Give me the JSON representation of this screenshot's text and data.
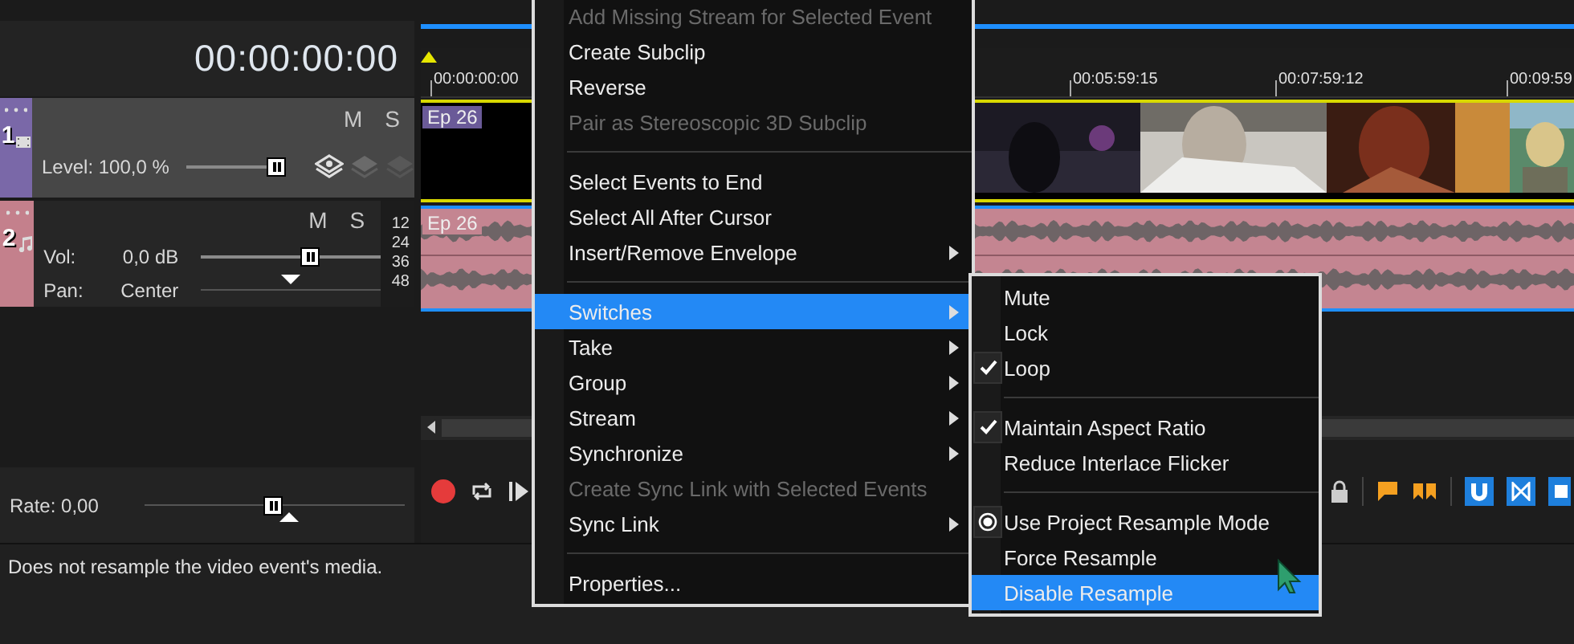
{
  "timecode": "00:00:00:00",
  "tracks": [
    {
      "kind": "video",
      "number": "1",
      "color": "#7a68a8",
      "mute": "M",
      "solo": "S",
      "level_label": "Level: 100,0 %",
      "level": 1
    },
    {
      "kind": "audio",
      "number": "2",
      "color": "#c4808c",
      "mute": "M",
      "solo": "S",
      "vol_label": "Vol:",
      "vol_value": "0,0 dB",
      "level": 0.62,
      "pan": {
        "label": "Pan:",
        "value": "Center",
        "level": 0.5
      }
    }
  ],
  "meter_ticks": [
    "12",
    "24",
    "36",
    "48"
  ],
  "ruler_labels": [
    "00:00:00:00",
    "00:05:59:15",
    "00:07:59:12",
    "00:09:59"
  ],
  "events": [
    {
      "kind": "video",
      "label": "Ep 26"
    },
    {
      "kind": "audio",
      "label": "Ep 26"
    }
  ],
  "rate": {
    "label": "Rate: 0,00",
    "level": 0.49
  },
  "status_bar": "Does not resample the video event's media.",
  "menu": {
    "items": [
      {
        "kind": "item",
        "label": "Add Missing Stream for Selected Event",
        "disabled": true,
        "has_submenu": false,
        "selected": false
      },
      {
        "kind": "item",
        "label": "Create Subclip",
        "disabled": false,
        "has_submenu": false,
        "selected": false
      },
      {
        "kind": "item",
        "label": "Reverse",
        "disabled": false,
        "has_submenu": false,
        "selected": false
      },
      {
        "kind": "item",
        "label": "Pair as Stereoscopic 3D Subclip",
        "disabled": true,
        "has_submenu": false,
        "selected": false
      },
      {
        "kind": "separator"
      },
      {
        "kind": "item",
        "label": "Select Events to End",
        "disabled": false,
        "has_submenu": false,
        "selected": false
      },
      {
        "kind": "item",
        "label": "Select All After Cursor",
        "disabled": false,
        "has_submenu": false,
        "selected": false
      },
      {
        "kind": "item",
        "label": "Insert/Remove Envelope",
        "disabled": false,
        "has_submenu": true,
        "selected": false
      },
      {
        "kind": "separator"
      },
      {
        "kind": "item",
        "label": "Switches",
        "disabled": false,
        "has_submenu": true,
        "selected": true
      },
      {
        "kind": "item",
        "label": "Take",
        "disabled": false,
        "has_submenu": true,
        "selected": false
      },
      {
        "kind": "item",
        "label": "Group",
        "disabled": false,
        "has_submenu": true,
        "selected": false
      },
      {
        "kind": "item",
        "label": "Stream",
        "disabled": false,
        "has_submenu": true,
        "selected": false
      },
      {
        "kind": "item",
        "label": "Synchronize",
        "disabled": false,
        "has_submenu": true,
        "selected": false
      },
      {
        "kind": "item",
        "label": "Create Sync Link with Selected Events",
        "disabled": true,
        "has_submenu": false,
        "selected": false
      },
      {
        "kind": "item",
        "label": "Sync Link",
        "disabled": false,
        "has_submenu": true,
        "selected": false
      },
      {
        "kind": "separator"
      },
      {
        "kind": "item",
        "label": "Properties...",
        "disabled": false,
        "has_submenu": false,
        "selected": false
      }
    ]
  },
  "submenu": {
    "items": [
      {
        "kind": "check",
        "label": "Mute",
        "checked": false,
        "selected": false
      },
      {
        "kind": "check",
        "label": "Lock",
        "checked": false,
        "selected": false
      },
      {
        "kind": "check",
        "label": "Loop",
        "checked": true,
        "selected": false
      },
      {
        "kind": "separator"
      },
      {
        "kind": "check",
        "label": "Maintain Aspect Ratio",
        "checked": true,
        "selected": false
      },
      {
        "kind": "check",
        "label": "Reduce Interlace Flicker",
        "checked": false,
        "selected": false
      },
      {
        "kind": "separator"
      },
      {
        "kind": "radio",
        "label": "Use Project Resample Mode",
        "checked": true,
        "selected": false
      },
      {
        "kind": "radio",
        "label": "Force Resample",
        "checked": false,
        "selected": false
      },
      {
        "kind": "radio",
        "label": "Disable Resample",
        "checked": false,
        "selected": true
      }
    ]
  }
}
